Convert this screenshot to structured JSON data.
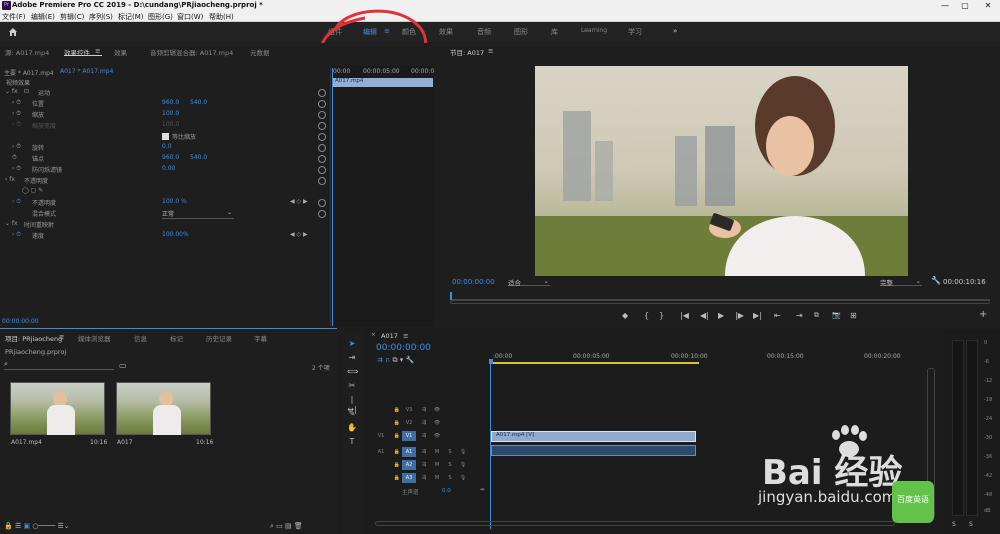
{
  "titlebar": {
    "app_icon": "Pr",
    "title": "Adobe Premiere Pro CC 2019 - D:\\cundang\\PRjiaocheng.prproj *",
    "minimize": "—",
    "restore": "▢",
    "close": "✕"
  },
  "menu": [
    "文件(F)",
    "编辑(E)",
    "剪辑(C)",
    "序列(S)",
    "标记(M)",
    "图形(G)",
    "窗口(W)",
    "帮助(H)"
  ],
  "workspaces": {
    "items": [
      "组件",
      "编辑",
      "颜色",
      "效果",
      "音频",
      "图形",
      "库",
      "Learning",
      "学习"
    ],
    "active": "编辑",
    "menu_glyph": "≡",
    "more": "»"
  },
  "effect_panel": {
    "tabs": [
      "源: A017.mp4",
      "效果控件",
      "效果",
      "音频剪辑混合器: A017.mp4",
      "元数据"
    ],
    "tab_menu": "≡",
    "master": "主要 * A017.mp4",
    "sequence_clip": "A017 * A017.mp4",
    "section_video": "视频效果",
    "motion": "运动",
    "props": [
      {
        "label": "位置",
        "v1": "960.0",
        "v2": "540.0"
      },
      {
        "label": "缩放",
        "v1": "100.0",
        "v2": ""
      },
      {
        "label": "缩放宽度",
        "v1": "100.0",
        "v2": ""
      },
      {
        "label": "等比缩放",
        "v1": "",
        "v2": ""
      },
      {
        "label": "旋转",
        "v1": "0.0",
        "v2": ""
      },
      {
        "label": "锚点",
        "v1": "960.0",
        "v2": "540.0"
      },
      {
        "label": "防闪烁滤镜",
        "v1": "0.00",
        "v2": ""
      }
    ],
    "opacity_section": "不透明度",
    "opacity_label": "不透明度",
    "opacity_value": "100.0 %",
    "blend_label": "混合模式",
    "blend_value": "正常",
    "time_remap": "时间重映射",
    "speed_label": "速度",
    "speed_value": "100.00%",
    "timecode": "00:00:00:00",
    "ruler": [
      "00:00",
      "00:00:05:00",
      "00:00:0"
    ],
    "clip": "A017.mp4"
  },
  "program": {
    "title": "节目: A017",
    "tab_menu": "≡",
    "timecode": "00:00:00:00",
    "fit": "适合",
    "quality": "完整",
    "duration": "00:00:10:16",
    "controls": [
      "◆",
      "{",
      "}",
      "|◀",
      "◀|",
      "▶",
      "|▶",
      "▶|",
      "⇤",
      "⇥",
      "⧉",
      "📷",
      "⊞"
    ],
    "add": "+"
  },
  "project": {
    "tabs": [
      "项目: PRjiaocheng",
      "媒体浏览器",
      "信息",
      "标记",
      "历史记录",
      "字幕"
    ],
    "tab_menu": "≡",
    "file": "PRjiaocheng.prproj",
    "search_icon": "⌕",
    "count": "2 个项",
    "items": [
      {
        "name": "A017.mp4",
        "duration": "10:16"
      },
      {
        "name": "A017",
        "duration": "10:16"
      }
    ]
  },
  "timeline": {
    "tab": "A017",
    "tab_menu": "≡",
    "close": "×",
    "timecode": "00:00:00:00",
    "ruler": [
      ":00:00",
      "00:00:05:00",
      "00:00:10:00",
      "00:00:15:00",
      "00:00:20:00"
    ],
    "video_tracks": [
      "V3",
      "V2",
      "V1"
    ],
    "audio_tracks": [
      "A1",
      "A2",
      "A3"
    ],
    "v1_source": "V1",
    "a1_source": "A1",
    "master": "主声道",
    "master_value": "0.0",
    "clip_label": "A017.mp4 [V]",
    "m": "M",
    "s": "S"
  },
  "meter": {
    "labels": [
      "0",
      "-6",
      "-12",
      "-18",
      "-24",
      "-30",
      "-36",
      "-42",
      "-48",
      "dB"
    ],
    "solo": [
      "S",
      "S"
    ]
  },
  "watermark": {
    "brand": "Bai 经验",
    "url": "jingyan.baidu.com",
    "badge": "百度英语"
  }
}
